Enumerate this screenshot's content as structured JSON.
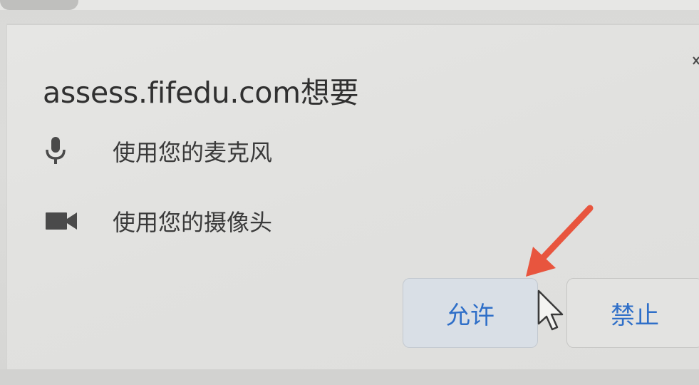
{
  "dialog": {
    "title": "assess.fifedu.com想要",
    "permissions": [
      {
        "icon": "microphone-icon",
        "label": "使用您的麦克风"
      },
      {
        "icon": "video-camera-icon",
        "label": "使用您的摄像头"
      }
    ],
    "allow_label": "允许",
    "deny_label": "禁止"
  },
  "colors": {
    "button_text": "#2f6fc8",
    "arrow": "#e8553e",
    "icon": "#4a4a4a"
  }
}
